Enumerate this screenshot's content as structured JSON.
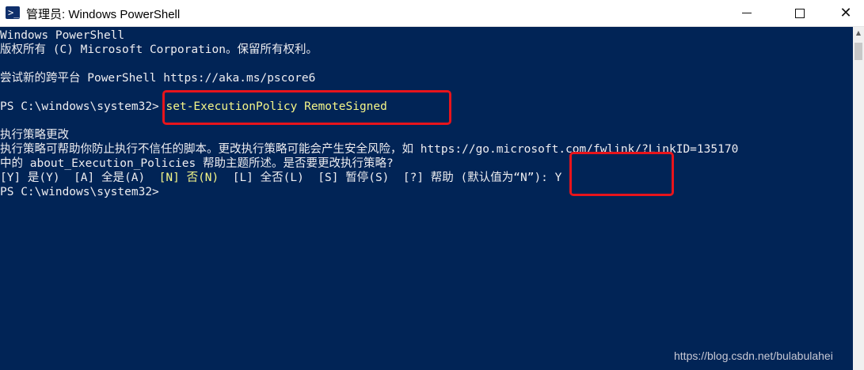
{
  "window": {
    "title": "管理员: Windows PowerShell",
    "icon": "powershell-icon",
    "controls": {
      "minimize": "minimize-icon",
      "maximize": "maximize-icon",
      "close": "close-icon"
    }
  },
  "console": {
    "lines": [
      "Windows PowerShell",
      "版权所有 (C) Microsoft Corporation。保留所有权利。",
      "",
      "尝试新的跨平台 PowerShell https://aka.ms/pscore6",
      "",
      "PS C:\\windows\\system32> ",
      "",
      "执行策略更改",
      "执行策略可帮助你防止执行不信任的脚本。更改执行策略可能会产生安全风险，如 https://go.microsoft.com/fwlink/?LinkID=135170",
      "中的 about_Execution_Policies 帮助主题所述。是否要更改执行策略?",
      "",
      "PS C:\\windows\\system32>"
    ],
    "command": "set-ExecutionPolicy RemoteSigned",
    "prompt_choices": {
      "y": "[Y] 是(Y)  ",
      "a": "[A] 全是(A)  ",
      "n": "[N] 否(N)",
      "l": "  [L] 全否(L)  ",
      "s": "[S] 暂停(S)  ",
      "help": "[?] 帮助 (默认值为“N”): Y"
    }
  },
  "watermark": "https://blog.csdn.net/bulabulahei",
  "colors": {
    "console_bg": "#012456",
    "text": "#eeedf0",
    "highlight": "#f5f588",
    "annotation": "#e8141b"
  }
}
